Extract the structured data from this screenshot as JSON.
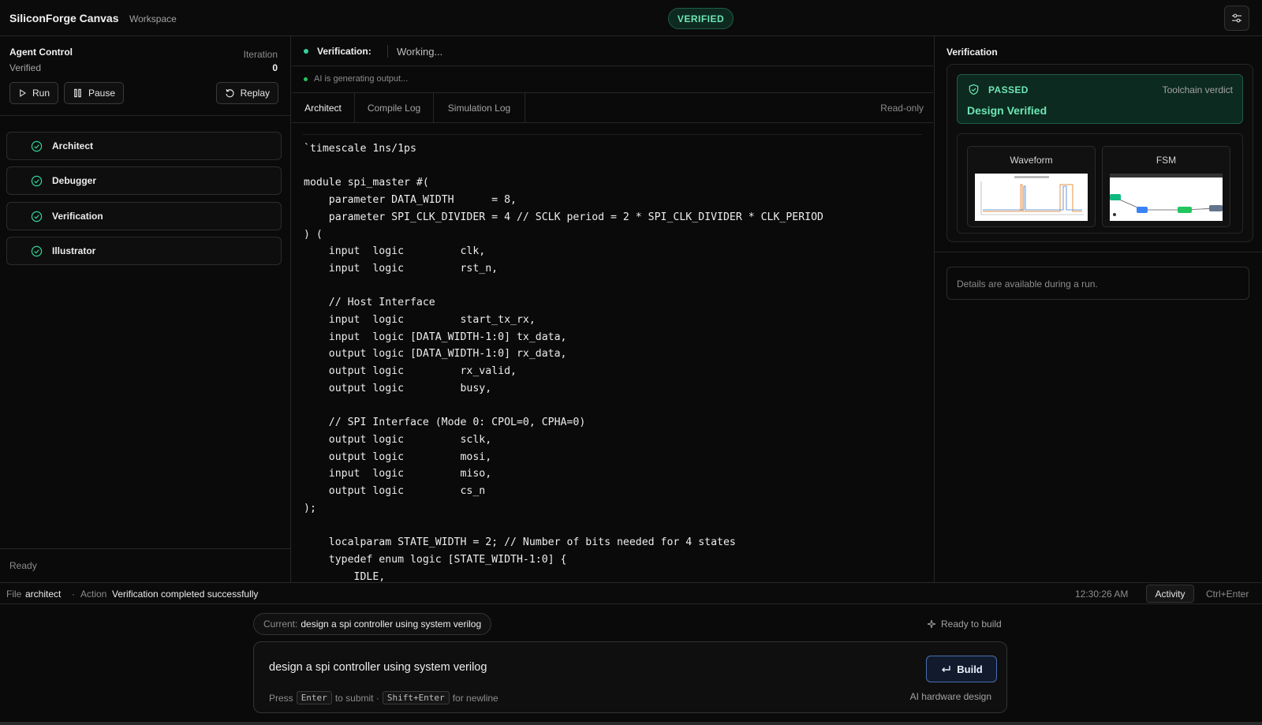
{
  "header": {
    "app_title": "SiliconForge Canvas",
    "subtitle": "Workspace",
    "status_pill": "VERIFIED",
    "settings_icon": "sliders-icon"
  },
  "agent_control": {
    "title": "Agent Control",
    "status": "Verified",
    "iteration_label": "Iteration",
    "iteration_value": "0",
    "run_label": "Run",
    "pause_label": "Pause",
    "replay_label": "Replay",
    "agents": [
      {
        "label": "Architect",
        "icon": "check-circle-icon"
      },
      {
        "label": "Debugger",
        "icon": "check-circle-icon"
      },
      {
        "label": "Verification",
        "icon": "check-circle-icon"
      },
      {
        "label": "Illustrator",
        "icon": "check-circle-icon"
      }
    ],
    "footer_status": "Ready"
  },
  "center": {
    "verification_label": "Verification:",
    "verification_state": "Working...",
    "generating_text": "AI is generating output...",
    "tabs": [
      {
        "label": "Architect",
        "active": true
      },
      {
        "label": "Compile Log",
        "active": false
      },
      {
        "label": "Simulation Log",
        "active": false
      }
    ],
    "mode_label": "Read-only",
    "code": "`timescale 1ns/1ps\n\nmodule spi_master #(\n    parameter DATA_WIDTH      = 8,\n    parameter SPI_CLK_DIVIDER = 4 // SCLK period = 2 * SPI_CLK_DIVIDER * CLK_PERIOD\n) (\n    input  logic         clk,\n    input  logic         rst_n,\n\n    // Host Interface\n    input  logic         start_tx_rx,\n    input  logic [DATA_WIDTH-1:0] tx_data,\n    output logic [DATA_WIDTH-1:0] rx_data,\n    output logic         rx_valid,\n    output logic         busy,\n\n    // SPI Interface (Mode 0: CPOL=0, CPHA=0)\n    output logic         sclk,\n    output logic         mosi,\n    input  logic         miso,\n    output logic         cs_n\n);\n\n    localparam STATE_WIDTH = 2; // Number of bits needed for 4 states\n    typedef enum logic [STATE_WIDTH-1:0] {\n        IDLE,"
  },
  "verification_panel": {
    "title": "Verification",
    "passed_label": "PASSED",
    "verdict_label": "Toolchain verdict",
    "result": "Design Verified",
    "thumbnails": [
      {
        "label": "Waveform"
      },
      {
        "label": "FSM"
      }
    ],
    "details_text": "Details are available during a run."
  },
  "statusbar": {
    "file_label": "File",
    "file_value": "architect",
    "action_label": "Action",
    "action_value": "Verification completed successfully",
    "time": "12:30:26 AM",
    "activity_label": "Activity",
    "shortcut": "Ctrl+Enter"
  },
  "composer": {
    "current_label": "Current:",
    "current_value": "design a spi controller using system verilog",
    "ready_label": "Ready to build",
    "input_value": "design a spi controller using system verilog",
    "build_label": "Build",
    "hint_press": "Press",
    "hint_enter": "Enter",
    "hint_submit": "to submit ·",
    "hint_shift": "Shift+Enter",
    "hint_newline": "for newline",
    "footer_right": "AI hardware design"
  },
  "colors": {
    "accent_green": "#6ee7b7",
    "accent_blue": "#4a6fb0",
    "background": "#0a0a0a"
  }
}
